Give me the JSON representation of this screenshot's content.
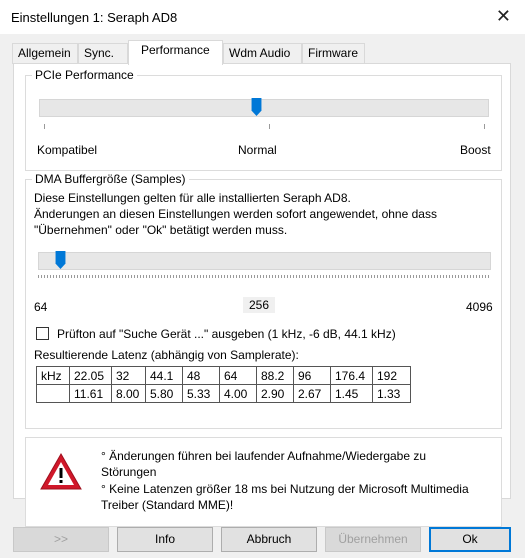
{
  "window": {
    "title": "Einstellungen 1: Seraph AD8",
    "close_glyph": "✕"
  },
  "tabs": [
    {
      "label": "Allgemein",
      "active": false
    },
    {
      "label": "Sync.",
      "active": false
    },
    {
      "label": "Performance",
      "active": true
    },
    {
      "label": "Wdm Audio",
      "active": false
    },
    {
      "label": "Firmware",
      "active": false
    }
  ],
  "pcie": {
    "legend": "PCIe Performance",
    "value_position": 0.5,
    "labels": {
      "min": "Kompatibel",
      "mid": "Normal",
      "max": "Boost"
    }
  },
  "dma": {
    "legend": "DMA Buffergröße (Samples)",
    "description_line1": "Diese Einstellungen gelten für alle installierten Seraph AD8.",
    "description_line2": "Änderungen an diesen Einstellungen werden sofort angewendet, ohne dass",
    "description_line3": "\"Übernehmen\" oder \"Ok\" betätigt werden muss.",
    "min_label": "64",
    "current_value": "256",
    "max_label": "4096",
    "slider_fraction": 0.05
  },
  "test_tone": {
    "label": "Prüfton auf \"Suche Gerät ...\" ausgeben (1 kHz, -6 dB,  44.1 kHz)",
    "checked": false
  },
  "latency": {
    "caption": "Resultierende Latenz (abhängig von Samplerate):",
    "header_label": "kHz",
    "rates": [
      "22.05",
      "32",
      "44.1",
      "48",
      "64",
      "88.2",
      "96",
      "176.4",
      "192"
    ],
    "values": [
      "11.61",
      "8.00",
      "5.80",
      "5.33",
      "4.00",
      "2.90",
      "2.67",
      "1.45",
      "1.33"
    ]
  },
  "warning": {
    "icon": "warning-triangle-icon",
    "line1": "° Änderungen führen bei laufender Aufnahme/Wiedergabe zu",
    "line2": "Störungen",
    "line3": "° Keine Latenzen größer  18 ms bei Nutzung der Microsoft Multimedia",
    "line4": "Treiber (Standard MME)!"
  },
  "buttons": {
    "more": ">>",
    "info": "Info",
    "cancel": "Abbruch",
    "apply": "Übernehmen",
    "ok": "Ok"
  },
  "colors": {
    "slider_thumb": "#0078d7",
    "warning_red": "#d0182a"
  }
}
